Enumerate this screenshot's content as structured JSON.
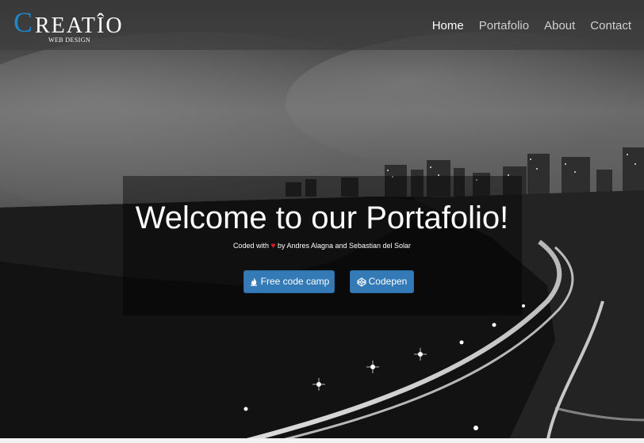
{
  "brand": {
    "initial": "C",
    "name": "REATÎO",
    "tagline": "WEB DESIGN",
    "accent_color": "#1e88c9"
  },
  "nav": {
    "items": [
      {
        "label": "Home",
        "active": true
      },
      {
        "label": "Portafolio",
        "active": false
      },
      {
        "label": "About",
        "active": false
      },
      {
        "label": "Contact",
        "active": false
      }
    ]
  },
  "hero": {
    "title": "Welcome to our Portafolio!",
    "credit_prefix": "Coded with",
    "credit_icon": "heart-icon",
    "credit_suffix": "by Andres Alagna and Sebastian del Solar",
    "heart_color": "#e31b23",
    "buttons": [
      {
        "label": "Free code camp",
        "icon": "fire-icon"
      },
      {
        "label": "Codepen",
        "icon": "codepen-icon"
      }
    ],
    "button_color": "#337ab7"
  }
}
